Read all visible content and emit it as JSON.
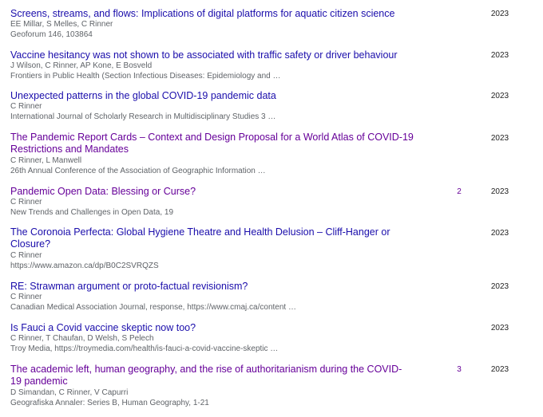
{
  "articles": [
    {
      "title": "Screens, streams, and flows: Implications of digital platforms for aquatic citizen science",
      "authors": "EE Millar, S Melles, C Rinner",
      "venue": "Geoforum 146, 103864",
      "cited_by": "",
      "year": "2023",
      "visited": false
    },
    {
      "title": "Vaccine hesitancy was not shown to be associated with traffic safety or driver behaviour",
      "authors": "J Wilson, C Rinner, AP Kone, E Bosveld",
      "venue": "Frontiers in Public Health (Section Infectious Diseases: Epidemiology and …",
      "cited_by": "",
      "year": "2023",
      "visited": false
    },
    {
      "title": "Unexpected patterns in the global COVID-19 pandemic data",
      "authors": "C Rinner",
      "venue": "International Journal of Scholarly Research in Multidisciplinary Studies 3 …",
      "cited_by": "",
      "year": "2023",
      "visited": false
    },
    {
      "title": "The Pandemic Report Cards – Context and Design Proposal for a World Atlas of COVID-19 Restrictions and Mandates",
      "authors": "C Rinner, L Manwell",
      "venue": "26th Annual Conference of the Association of Geographic Information …",
      "cited_by": "",
      "year": "2023",
      "visited": true
    },
    {
      "title": "Pandemic Open Data: Blessing or Curse?",
      "authors": "C Rinner",
      "venue": "New Trends and Challenges in Open Data, 19",
      "cited_by": "2",
      "year": "2023",
      "visited": true
    },
    {
      "title": "The Coronoia Perfecta: Global Hygiene Theatre and Health Delusion – Cliff-Hanger or Closure?",
      "authors": "C Rinner",
      "venue": "https://www.amazon.ca/dp/B0C2SVRQZS",
      "cited_by": "",
      "year": "2023",
      "visited": false
    },
    {
      "title": "RE: Strawman argument or proto-factual revisionism?",
      "authors": "C Rinner",
      "venue": "Canadian Medical Association Journal, response, https://www.cmaj.ca/content …",
      "cited_by": "",
      "year": "2023",
      "visited": false
    },
    {
      "title": "Is Fauci a Covid vaccine skeptic now too?",
      "authors": "C Rinner, T Chaufan, D Welsh, S Pelech",
      "venue": "Troy Media, https://troymedia.com/health/is-fauci-a-covid-vaccine-skeptic …",
      "cited_by": "",
      "year": "2023",
      "visited": false
    },
    {
      "title": "The academic left, human geography, and the rise of authoritarianism during the COVID-19 pandemic",
      "authors": "D Simandan, C Rinner, V Capurri",
      "venue": "Geografiska Annaler: Series B, Human Geography, 1-21",
      "cited_by": "3",
      "year": "2023",
      "visited": true
    }
  ]
}
